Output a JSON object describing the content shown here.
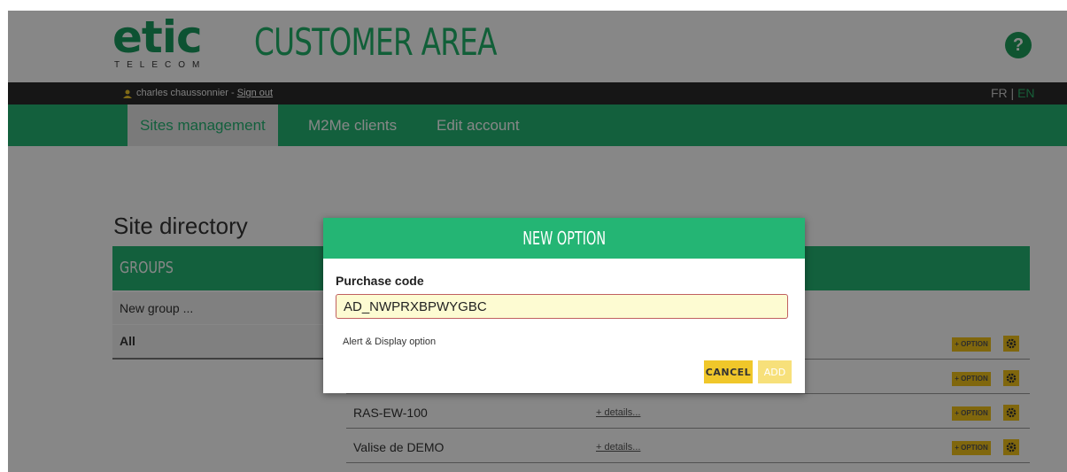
{
  "header": {
    "logo_text": "etic",
    "logo_subtext": "TELECOM",
    "title": "CUSTOMER AREA",
    "help_label": "?"
  },
  "userbar": {
    "user_name": "charles chaussonnier - ",
    "sign_out": "Sign out",
    "lang_fr": "FR",
    "lang_sep": " | ",
    "lang_en": "EN"
  },
  "nav": {
    "items": [
      {
        "label": "Sites management"
      },
      {
        "label": "M2Me clients"
      },
      {
        "label": "Edit account"
      }
    ]
  },
  "content": {
    "title": "Site directory",
    "groups_label": "GROUPS",
    "groups": [
      {
        "label": "New group ..."
      },
      {
        "label": "All"
      }
    ],
    "sites": [
      {
        "name": "",
        "details": ""
      },
      {
        "name": "",
        "details": ""
      },
      {
        "name": "RAS-EW-100",
        "details": "+ details..."
      },
      {
        "name": "Valise de DEMO",
        "details": "+ details..."
      }
    ],
    "option_button": "+ OPTION"
  },
  "modal": {
    "title": "NEW OPTION",
    "purchase_code_label": "Purchase code",
    "purchase_code_value": "AD_NWPRXBPWYGBC",
    "description": "Alert & Display option",
    "cancel_label": "CANCEL",
    "add_label": "ADD"
  },
  "colors": {
    "brand_green": "#24b574",
    "button_yellow": "#f0c72a",
    "dark_bar": "#2a2a2a"
  },
  "icons": [
    "user-icon",
    "help-icon",
    "gear-icon"
  ]
}
